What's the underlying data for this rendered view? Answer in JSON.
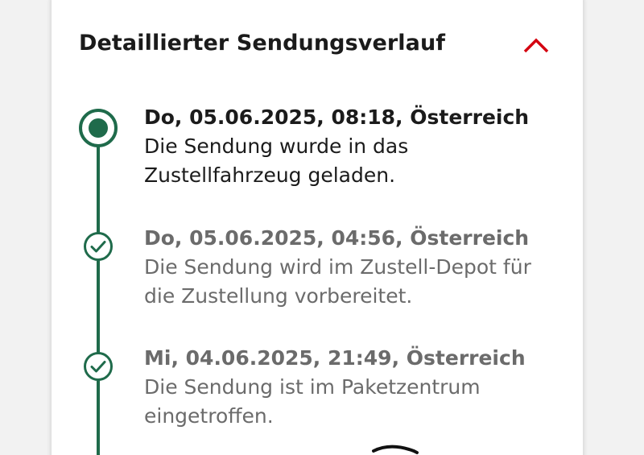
{
  "section": {
    "title": "Detaillierter Sendungsverlauf",
    "toggle_icon": "chevron-up-icon"
  },
  "colors": {
    "timeline": "#1f6b4b",
    "accent_red": "#d40511",
    "text_primary": "#1b1b1b",
    "text_secondary": "#6b6b6b"
  },
  "events": [
    {
      "date": "Do, 05.06.2025, 08:18, Österreich",
      "line1": "Die Sendung wurde in das",
      "line2": "Zustellfahrzeug geladen.",
      "status_icon": "current-status-icon"
    },
    {
      "date": "Do, 05.06.2025, 04:56, Österreich",
      "line1": "Die Sendung wird im Zustell-Depot für",
      "line2": "die Zustellung vorbereitet.",
      "status_icon": "check-circle-icon"
    },
    {
      "date": "Mi, 04.06.2025, 21:49, Österreich",
      "line1": "Die Sendung ist im Paketzentrum",
      "line2": "eingetroffen.",
      "status_icon": "check-circle-icon"
    }
  ]
}
